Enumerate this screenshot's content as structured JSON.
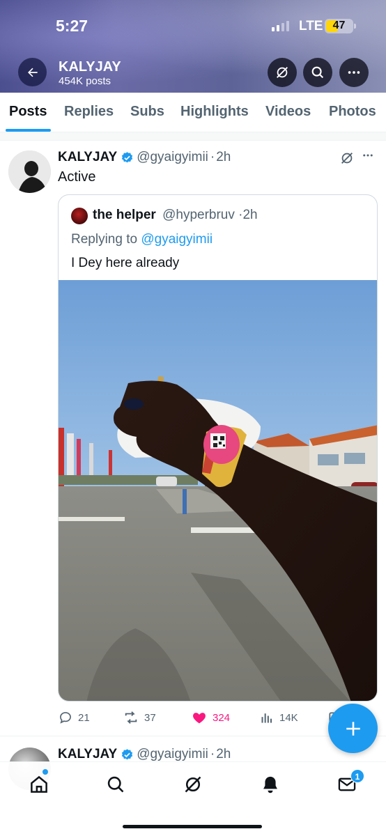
{
  "status_bar": {
    "time": "5:27",
    "network": "LTE",
    "battery": "47",
    "battery_level": 0.47
  },
  "header": {
    "title": "KALYJAY",
    "subtitle": "454K posts",
    "icons": [
      "back-arrow-icon",
      "grok-icon",
      "search-icon",
      "more-icon"
    ]
  },
  "tabs": [
    {
      "label": "Posts",
      "active": true
    },
    {
      "label": "Replies"
    },
    {
      "label": "Subs"
    },
    {
      "label": "Highlights"
    },
    {
      "label": "Videos"
    },
    {
      "label": "Photos"
    }
  ],
  "post": {
    "author_name": "KALYJAY",
    "author_handle": "@gyaigyimii",
    "time": "2h",
    "text": "Active",
    "quote": {
      "author_name": "the helper",
      "author_handle": "@hyperbruv",
      "time": "2h",
      "replying_label": "Replying to",
      "replying_mention": "@gyaigyimii",
      "text": "I Dey here already"
    },
    "stats": {
      "replies": "21",
      "reposts": "37",
      "likes": "324",
      "views": "14K"
    }
  },
  "next_post": {
    "author_name": "KALYJAY",
    "author_handle": "@gyaigyimii",
    "time": "2h"
  },
  "bottom_nav": {
    "items": [
      "home-icon",
      "search-icon",
      "grok-icon",
      "notifications-icon",
      "messages-icon"
    ],
    "messages_badge": "1"
  },
  "colors": {
    "accent": "#1d9bf0",
    "like": "#f91880",
    "text": "#0f1419",
    "muted": "#536471"
  }
}
